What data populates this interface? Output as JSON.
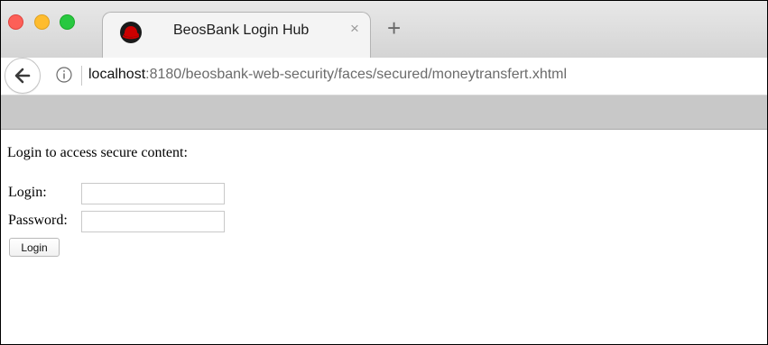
{
  "window": {
    "controls": [
      "close",
      "minimize",
      "zoom"
    ]
  },
  "tab": {
    "title": "BeosBank Login Hub",
    "favicon": "redhat-icon",
    "close_glyph": "×"
  },
  "new_tab_glyph": "+",
  "address_bar": {
    "host": "localhost",
    "rest": ":8180/beosbank-web-security/faces/secured/moneytransfert.xhtml"
  },
  "page": {
    "heading": "Login to access secure content:",
    "login_label": "Login:",
    "password_label": "Password:",
    "login_value": "",
    "password_value": "",
    "submit_label": "Login"
  },
  "colors": {
    "traffic_red": "#fd5f57",
    "traffic_yellow": "#febc2e",
    "traffic_green": "#28c840",
    "toolbar_gray": "#c8c8c8",
    "favicon_red": "#cc0000"
  }
}
